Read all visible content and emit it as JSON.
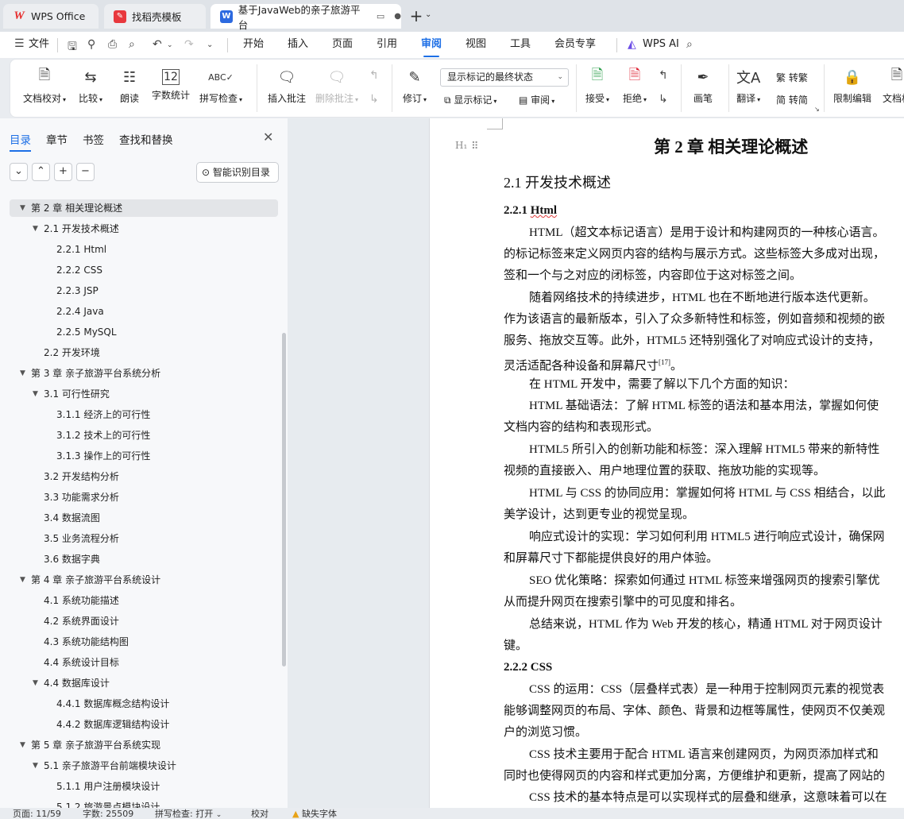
{
  "tabs": [
    {
      "label": "WPS Office",
      "icon": "wps-logo-icon",
      "color": "#e62c2c"
    },
    {
      "label": "找稻壳模板",
      "icon": "docer-logo-icon",
      "color": "#e8383d"
    },
    {
      "label": "基于JavaWeb的亲子旅游平台",
      "icon": "word-doc-icon",
      "color": "#2d6ae0"
    }
  ],
  "menu": {
    "file": "文件",
    "items": [
      "开始",
      "插入",
      "页面",
      "引用",
      "审阅",
      "视图",
      "工具",
      "会员专享"
    ],
    "active": "审阅",
    "ai": "WPS AI"
  },
  "ribbon": {
    "doc_check": "文档校对",
    "compare": "比较",
    "read_aloud": "朗读",
    "word_count": "字数统计",
    "spell_check": "拼写检查",
    "insert_comment": "插入批注",
    "delete_comment": "删除批注",
    "track": "修订",
    "markup_mode": "显示标记的最终状态",
    "show_markup": "显示标记",
    "review_pane": "审阅",
    "accept": "接受",
    "reject": "拒绝",
    "ink": "画笔",
    "translate": "翻译",
    "to_traditional": "转繁",
    "to_simplified": "转简",
    "restrict_edit": "限制编辑",
    "doc_perm": "文档权"
  },
  "nav": {
    "tabs": [
      "目录",
      "章节",
      "书签",
      "查找和替换"
    ],
    "active_tab": "目录",
    "smart_toc": "智能识别目录",
    "toc": [
      {
        "text": "第 2 章 相关理论概述",
        "level": 1,
        "arrow": "▼",
        "selected": true
      },
      {
        "text": "2.1 开发技术概述",
        "level": 2,
        "arrow": "▼"
      },
      {
        "text": "2.2.1 Html",
        "level": 3
      },
      {
        "text": "2.2.2 CSS",
        "level": 3
      },
      {
        "text": "2.2.3 JSP",
        "level": 3
      },
      {
        "text": "2.2.4 Java",
        "level": 3
      },
      {
        "text": "2.2.5 MySQL",
        "level": 3
      },
      {
        "text": "2.2  开发环境",
        "level": 2
      },
      {
        "text": "第 3 章 亲子旅游平台系统分析",
        "level": 1,
        "arrow": "▼"
      },
      {
        "text": "3.1 可行性研究",
        "level": 2,
        "arrow": "▼"
      },
      {
        "text": "3.1.1 经济上的可行性",
        "level": 3
      },
      {
        "text": "3.1.2 技术上的可行性",
        "level": 3
      },
      {
        "text": "3.1.3 操作上的可行性",
        "level": 3
      },
      {
        "text": "3.2 开发结构分析",
        "level": 2
      },
      {
        "text": "3.3 功能需求分析",
        "level": 2
      },
      {
        "text": "3.4  数据流图",
        "level": 2
      },
      {
        "text": "3.5  业务流程分析",
        "level": 2
      },
      {
        "text": "3.6  数据字典",
        "level": 2
      },
      {
        "text": "第 4 章 亲子旅游平台系统设计",
        "level": 1,
        "arrow": "▼"
      },
      {
        "text": "4.1 系统功能描述",
        "level": 2
      },
      {
        "text": "4.2 系统界面设计",
        "level": 2
      },
      {
        "text": "4.3 系统功能结构图",
        "level": 2
      },
      {
        "text": "4.4 系统设计目标",
        "level": 2
      },
      {
        "text": "4.4 数据库设计",
        "level": 2,
        "arrow": "▼"
      },
      {
        "text": "4.4.1 数据库概念结构设计",
        "level": 3
      },
      {
        "text": "4.4.2 数据库逻辑结构设计",
        "level": 3
      },
      {
        "text": "第 5 章 亲子旅游平台系统实现",
        "level": 1,
        "arrow": "▼"
      },
      {
        "text": "5.1 亲子旅游平台前端模块设计",
        "level": 2,
        "arrow": "▼"
      },
      {
        "text": "5.1.1 用户注册模块设计",
        "level": 3
      },
      {
        "text": "5.1.2 旅游景点模块设计",
        "level": 3
      }
    ]
  },
  "document": {
    "heading_marker": "H₁",
    "chapter_title": "第 2 章  相关理论概述",
    "section_title": "2.1 开发技术概述",
    "sub_html": "2.2.1 Html",
    "sub_html_num": "2.2.1 ",
    "sub_html_word": "Html",
    "p1": [
      "HTML（超文本标记语言）是用于设计和构建网页的一种核心语言。",
      "的标记标签来定义网页内容的结构与展示方式。这些标签大多成对出现，",
      "签和一个与之对应的闭标签，内容即位于这对标签之间。"
    ],
    "p2": [
      "随着网络技术的持续进步，HTML 也在不断地进行版本迭代更新。",
      "作为该语言的最新版本，引入了众多新特性和标签，例如音频和视频的嵌",
      "服务、拖放交互等。此外，HTML5 还特别强化了对响应式设计的支持，",
      "灵活适配各种设备和屏幕尺寸"
    ],
    "p2_cite": "[17]",
    "p2_end": "。",
    "p3": "在 HTML 开发中，需要了解以下几个方面的知识：",
    "p4": [
      "HTML 基础语法：了解 HTML 标签的语法和基本用法，掌握如何使",
      "文档内容的结构和表现形式。"
    ],
    "p5": [
      "HTML5 所引入的创新功能和标签：深入理解 HTML5 带来的新特性",
      "视频的直接嵌入、用户地理位置的获取、拖放功能的实现等。"
    ],
    "p6": [
      "HTML 与 CSS 的协同应用：掌握如何将 HTML 与 CSS 相结合，以此",
      "美学设计，达到更专业的视觉呈现。"
    ],
    "p7": [
      "响应式设计的实现：学习如何利用 HTML5 进行响应式设计，确保网",
      "和屏幕尺寸下都能提供良好的用户体验。"
    ],
    "p8": [
      "SEO 优化策略：探索如何通过 HTML 标签来增强网页的搜索引擎优",
      "从而提升网页在搜索引擎中的可见度和排名。"
    ],
    "p9": [
      "总结来说，HTML 作为 Web 开发的核心，精通 HTML 对于网页设计",
      "键。"
    ],
    "sub_css": "2.2.2 CSS",
    "p10": [
      "CSS 的运用：CSS（层叠样式表）是一种用于控制网页元素的视觉表",
      "能够调整网页的布局、字体、颜色、背景和边框等属性，使网页不仅美观",
      "户的浏览习惯。"
    ],
    "p11": [
      "CSS 技术主要用于配合 HTML 语言来创建网页，为网页添加样式和",
      "同时也使得网页的内容和样式更加分离，方便维护和更新，提高了网站的"
    ],
    "p12": "CSS 技术的基本特点是可以实现样式的层叠和继承，这意味着可以在"
  },
  "status": {
    "page": "页面: 11/59",
    "words": "字数: 25509",
    "spell": "拼写检查: 打开",
    "proof": "校对",
    "missing_font": "缺失字体"
  },
  "colors": {
    "accent": "#1d6fe6",
    "warning": "#e8a317"
  }
}
